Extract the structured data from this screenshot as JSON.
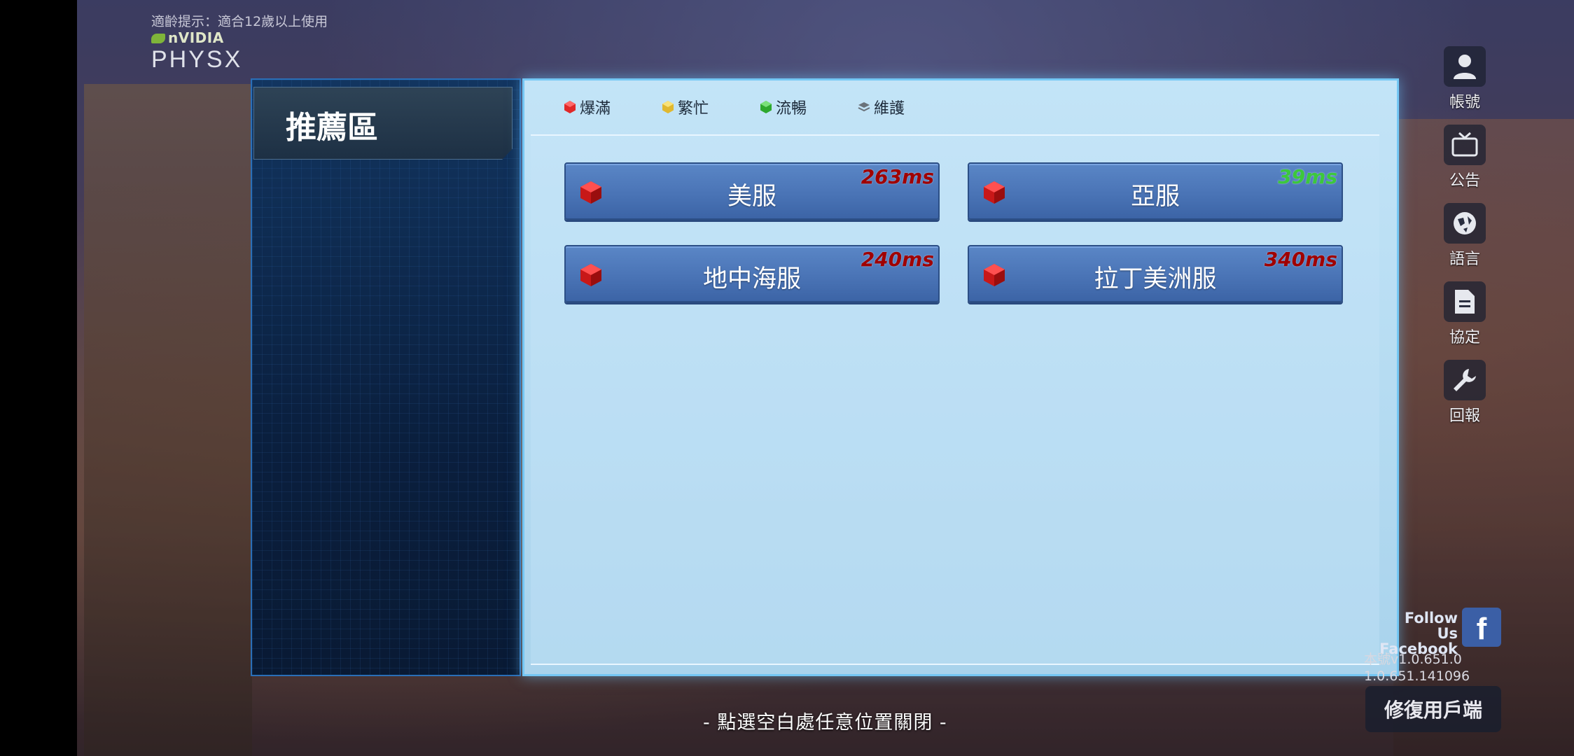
{
  "age_hint": "適齡提示：適合12歲以上使用",
  "nvidia_logo": {
    "brand": "nVIDIA",
    "product": "PHYSX"
  },
  "right_menu": [
    {
      "label": "帳號",
      "icon": "account-icon"
    },
    {
      "label": "公告",
      "icon": "announcement-icon"
    },
    {
      "label": "語言",
      "icon": "globe-icon"
    },
    {
      "label": "協定",
      "icon": "document-icon"
    },
    {
      "label": "回報",
      "icon": "wrench-icon"
    }
  ],
  "region_panel": {
    "recommend_tab": "推薦區"
  },
  "legend": [
    {
      "label": "爆滿",
      "color": "#e02828"
    },
    {
      "label": "繁忙",
      "color": "#f0d048"
    },
    {
      "label": "流暢",
      "color": "#3cc83c"
    },
    {
      "label": "維護",
      "color": "#707880"
    }
  ],
  "servers": [
    {
      "name": "美服",
      "ping": "263ms",
      "ping_color": "#a00000"
    },
    {
      "name": "亞服",
      "ping": "39ms",
      "ping_color": "#3cc83c"
    },
    {
      "name": "地中海服",
      "ping": "240ms",
      "ping_color": "#a00000"
    },
    {
      "name": "拉丁美洲服",
      "ping": "340ms",
      "ping_color": "#a00000"
    }
  ],
  "close_hint": "- 點選空白處任意位置關閉 -",
  "facebook": {
    "text": "Follow Us\nFacebook",
    "icon": "f"
  },
  "version": "本號v1.0.651.0\n1.0.651.141096",
  "repair_button": "修復用戶端"
}
